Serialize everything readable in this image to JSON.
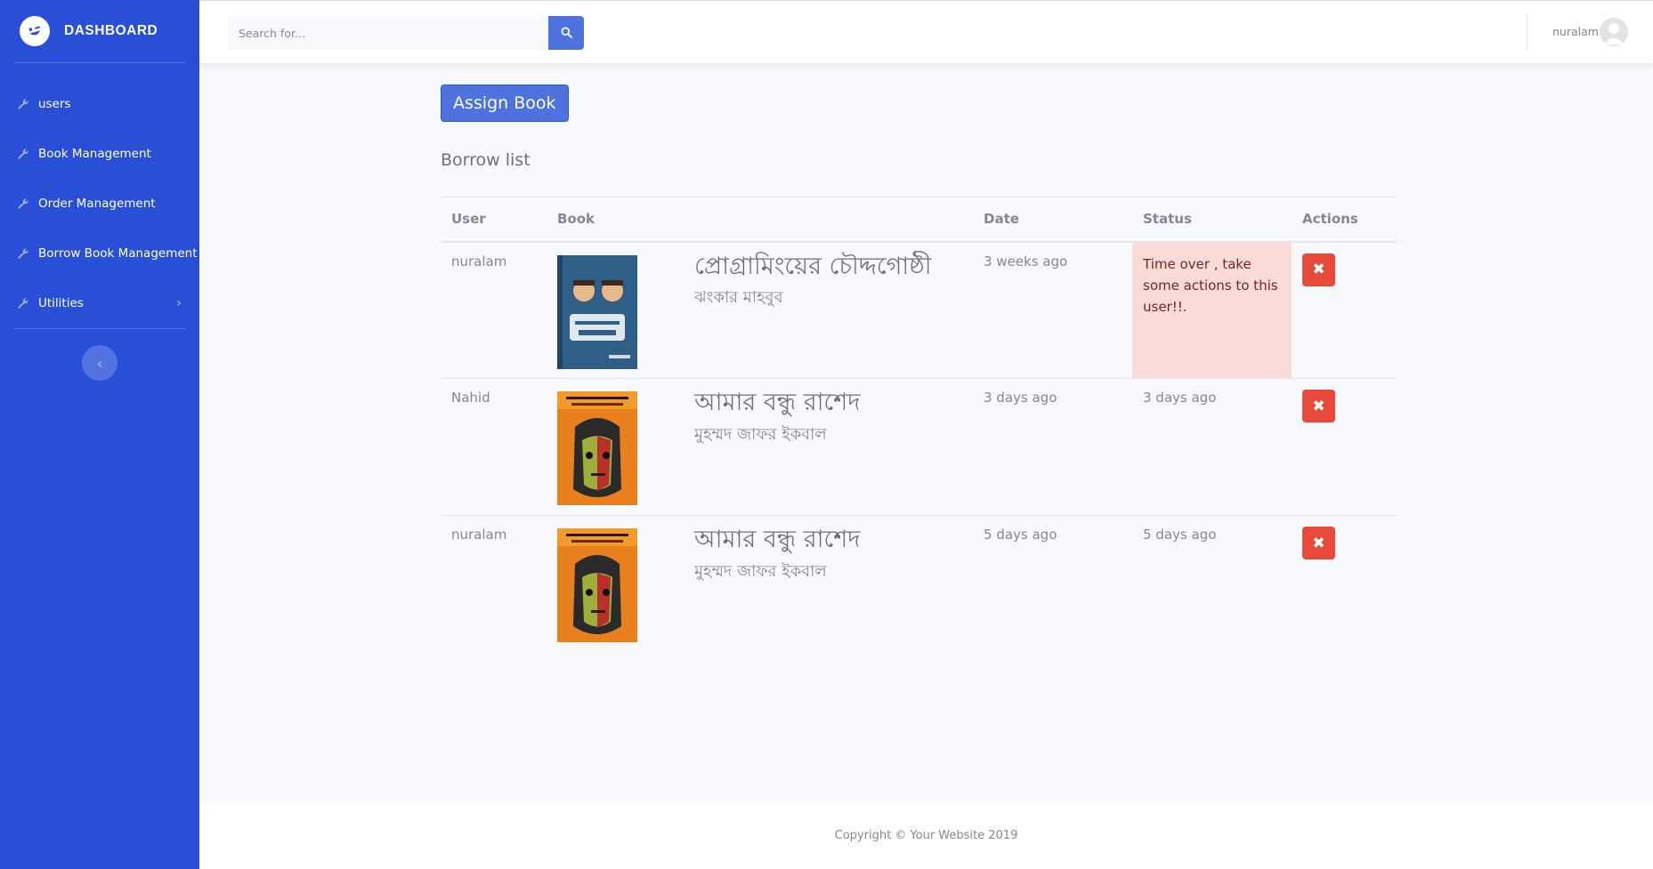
{
  "sidebar": {
    "brand": "DASHBOARD",
    "items": [
      {
        "label": "users",
        "icon": "wrench-icon"
      },
      {
        "label": "Book Management",
        "icon": "wrench-icon"
      },
      {
        "label": "Order Management",
        "icon": "wrench-icon"
      },
      {
        "label": "Borrow Book Management",
        "icon": "wrench-icon"
      },
      {
        "label": "Utilities",
        "icon": "wrench-icon"
      }
    ]
  },
  "topbar": {
    "search_placeholder": "Search for...",
    "user_name": "nuralam"
  },
  "main": {
    "assign_button": "Assign Book",
    "section_title": "Borrow list",
    "table": {
      "headers": [
        "User",
        "Book",
        "Date",
        "Status",
        "Actions"
      ],
      "rows": [
        {
          "user": "nuralam",
          "book_title": "প্রোগ্রামিংয়ের চৌদ্দগোষ্ঠী",
          "book_author": "ঝংকার মাহবুব",
          "date": "3 weeks ago",
          "status": "Time over , take some actions to this user!!.",
          "status_type": "danger"
        },
        {
          "user": "Nahid",
          "book_title": "আমার বন্ধু রাশেদ",
          "book_author": "মুহম্মদ জাফর ইকবাল",
          "date": "3 days ago",
          "status": "3 days ago",
          "status_type": "normal"
        },
        {
          "user": "nuralam",
          "book_title": "আমার বন্ধু রাশেদ",
          "book_author": "মুহম্মদ জাফর ইকবাল",
          "date": "5 days ago",
          "status": "5 days ago",
          "status_type": "normal"
        }
      ]
    }
  },
  "footer": {
    "text": "Copyright © Your Website 2019"
  },
  "colors": {
    "sidebar": "#2a4fd7",
    "primary": "#4e73df",
    "danger": "#e74a3b",
    "danger_bg": "#fadbd8"
  }
}
